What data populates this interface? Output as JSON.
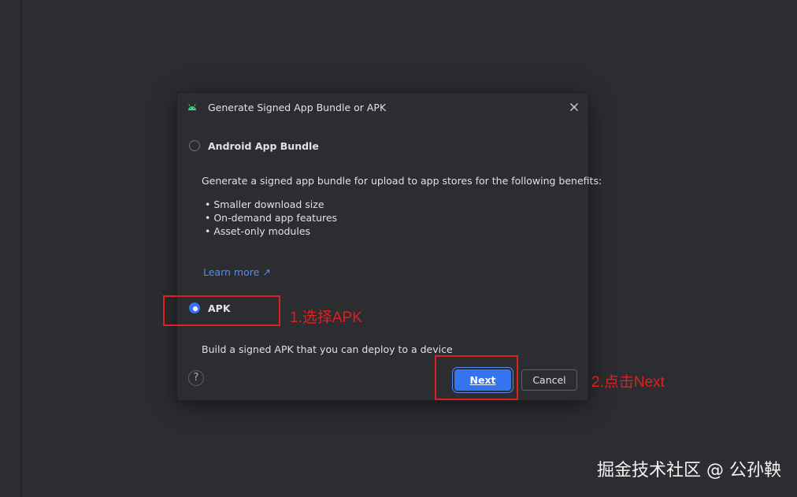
{
  "dialog": {
    "title": "Generate Signed App Bundle or APK",
    "close_glyph": "×",
    "options": [
      {
        "label": "Android App Bundle",
        "selected": false,
        "description": "Generate a signed app bundle for upload to app stores for the following benefits:",
        "benefits": [
          "• Smaller download size",
          "• On-demand app features",
          "• Asset-only modules"
        ],
        "learn_more": "Learn more ↗"
      },
      {
        "label": "APK",
        "selected": true,
        "description": "Build a signed APK that you can deploy to a device"
      }
    ],
    "help_glyph": "?",
    "next_label": "Next",
    "cancel_label": "Cancel"
  },
  "annotations": {
    "step1": "1.选择APK",
    "step2": "2.点击Next"
  },
  "watermark": "掘金技术社区 @ 公孙鞅",
  "colors": {
    "background": "#2b2d30",
    "accent": "#3574f0",
    "link": "#548af7",
    "annotation": "#e02020"
  },
  "icons": {
    "title": "android-icon",
    "close": "close-icon",
    "learn_more": "external-link-icon",
    "help": "help-icon"
  }
}
